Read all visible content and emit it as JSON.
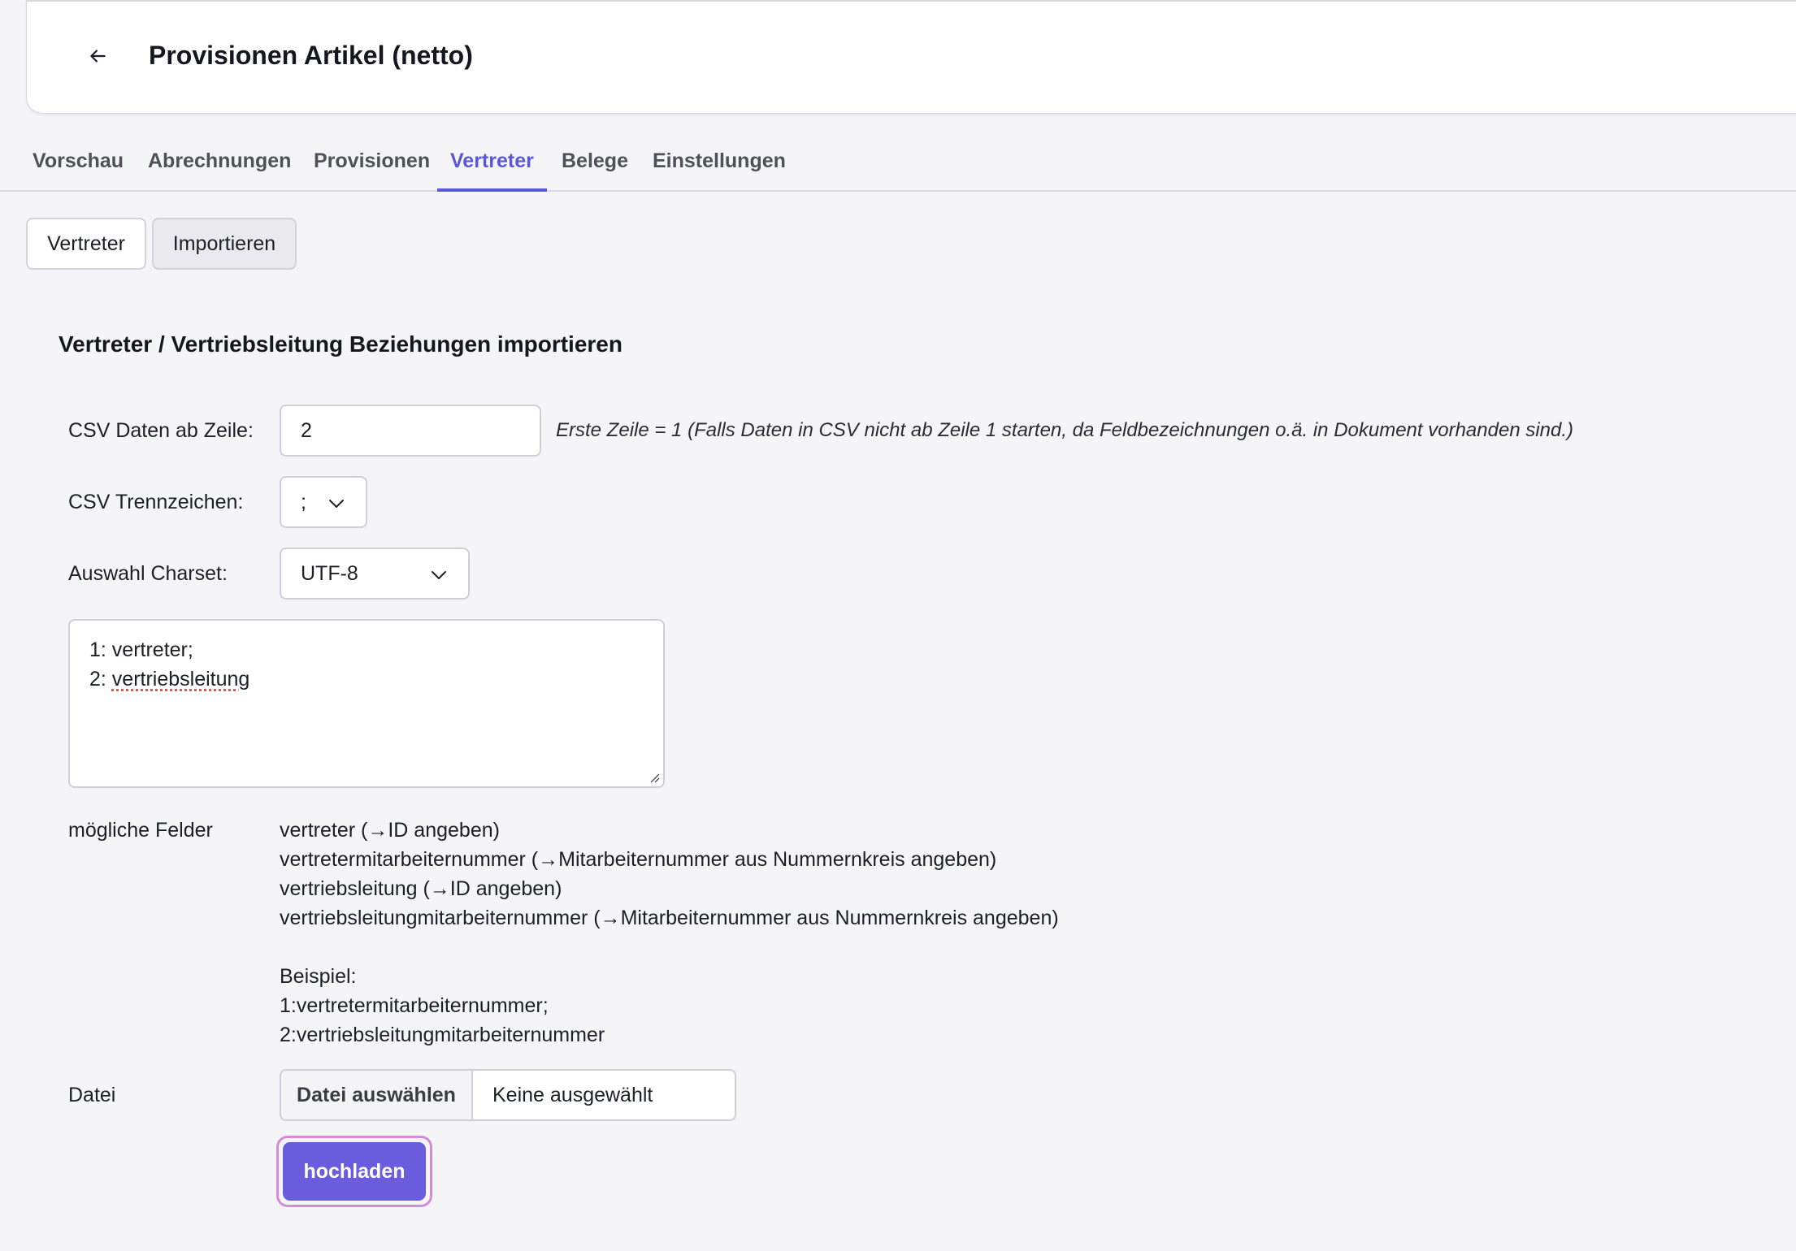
{
  "header": {
    "title": "Provisionen Artikel (netto)"
  },
  "tabs": [
    {
      "label": "Vorschau"
    },
    {
      "label": "Abrechnungen"
    },
    {
      "label": "Provisionen"
    },
    {
      "label": "Vertreter",
      "active": true
    },
    {
      "label": "Belege"
    },
    {
      "label": "Einstellungen"
    }
  ],
  "subnav": {
    "vertreter": "Vertreter",
    "importieren": "Importieren"
  },
  "form": {
    "section_title": "Vertreter / Vertriebsleitung Beziehungen importieren",
    "start_row_label": "CSV Daten ab Zeile:",
    "start_row_value": "2",
    "start_row_hint": "Erste Zeile = 1 (Falls Daten in CSV nicht ab Zeile 1 starten, da Feldbezeichnungen o.ä. in Dokument vorhanden sind.)",
    "separator_label": "CSV Trennzeichen:",
    "separator_value": ";",
    "charset_label": "Auswahl Charset:",
    "charset_value": "UTF-8",
    "mapping_line1": "1: vertreter;",
    "mapping_line2_prefix": "2: ",
    "mapping_line2_word": "vertriebsleitung",
    "fields_label": "mögliche Felder",
    "fields": [
      "vertreter (→ID angeben)",
      "vertretermitarbeiternummer (→Mitarbeiternummer aus Nummernkreis angeben)",
      "vertriebsleitung (→ID angeben)",
      "vertriebsleitungmitarbeiternummer (→Mitarbeiternummer aus Nummernkreis angeben)"
    ],
    "example_title": "Beispiel:",
    "example_lines": [
      "1:vertretermitarbeiternummer;",
      "2:vertriebsleitungmitarbeiternummer"
    ],
    "file_label": "Datei",
    "file_button": "Datei auswählen",
    "file_status": "Keine ausgewählt",
    "upload_button": "hochladen"
  },
  "colors": {
    "accent": "#5a58d8",
    "upload_bg": "#6b5cdd",
    "focus_ring": "#d58bd6"
  }
}
